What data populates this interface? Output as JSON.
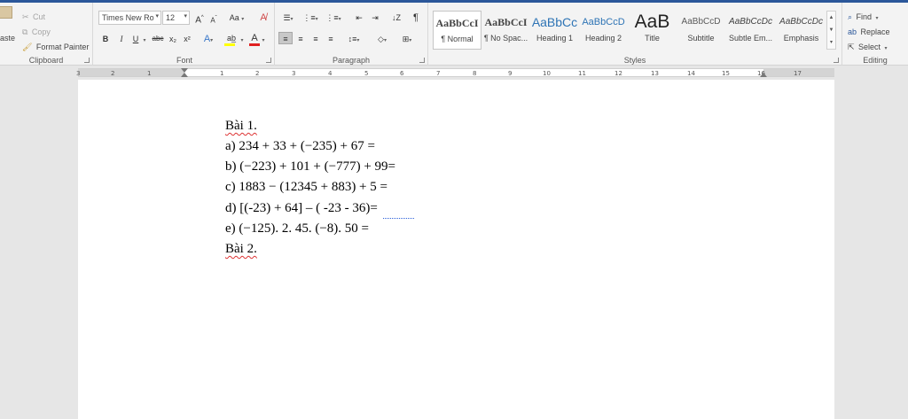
{
  "clipboard": {
    "paste_label": "aste",
    "cut_label": "Cut",
    "copy_label": "Copy",
    "format_painter_label": "Format Painter",
    "group_label": "Clipboard"
  },
  "font": {
    "font_name": "Times New Ro",
    "font_size": "12",
    "grow_label": "A",
    "shrink_label": "A",
    "case_label": "Aa",
    "bold": "B",
    "italic": "I",
    "underline": "U",
    "strike": "abc",
    "subscript": "x₂",
    "superscript": "x²",
    "effects": "A",
    "font_color": "A",
    "group_label": "Font"
  },
  "paragraph": {
    "show_marks": "¶",
    "group_label": "Paragraph"
  },
  "styles": {
    "items": [
      {
        "sample": "AaBbCcI",
        "name": "¶ Normal",
        "color": "#000000"
      },
      {
        "sample": "AaBbCcI",
        "name": "¶ No Spac...",
        "color": "#000000"
      },
      {
        "sample": "AaBbCc",
        "name": "Heading 1",
        "color": "#2e74b5"
      },
      {
        "sample": "AaBbCcD",
        "name": "Heading 2",
        "color": "#2e74b5"
      },
      {
        "sample": "AaB",
        "name": "Title",
        "color": "#222222"
      },
      {
        "sample": "AaBbCcD",
        "name": "Subtitle",
        "color": "#5a5a5a"
      },
      {
        "sample": "AaBbCcDc",
        "name": "Subtle Em...",
        "color": "#404040"
      },
      {
        "sample": "AaBbCcDc",
        "name": "Emphasis",
        "color": "#222222"
      }
    ],
    "group_label": "Styles"
  },
  "editing": {
    "find_label": "Find",
    "replace_label": "Replace",
    "select_label": "Select",
    "group_label": "Editing"
  },
  "ruler": {
    "numbers": [
      "3",
      "2",
      "1",
      "1",
      "2",
      "3",
      "4",
      "5",
      "6",
      "7",
      "8",
      "9",
      "10",
      "11",
      "12",
      "13",
      "14",
      "15",
      "16",
      "17"
    ]
  },
  "document": {
    "lines": [
      "Bài 1.",
      "a) 234 + 33 + (−235) + 67 =",
      "b) (−223) + 101 + (−777) + 99=",
      "c) 1883 − (12345 + 883) + 5 =",
      "d) [(-23) + 64] – ( -23 - 36)=",
      "e) (−125). 2. 45. (−8). 50  =",
      "Bài 2."
    ],
    "colors": {
      "accent": "#2b579a",
      "spell_error": "#dd3333",
      "grammar_error": "#2b5fd9"
    }
  }
}
